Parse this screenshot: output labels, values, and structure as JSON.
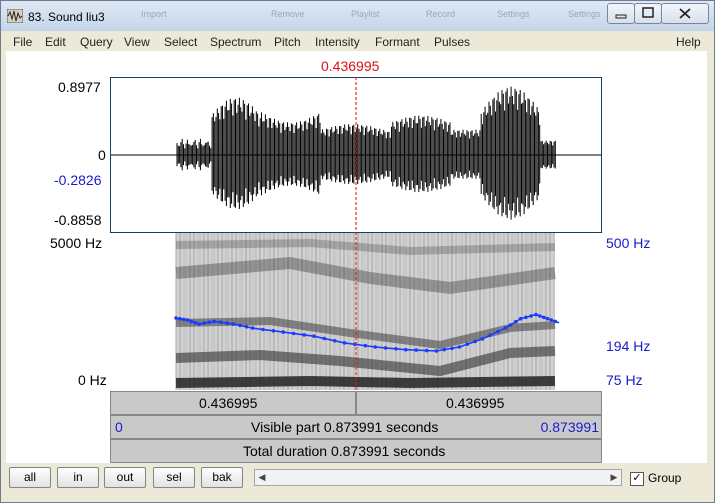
{
  "window": {
    "title": "83. Sound liu3",
    "ghost_titles": [
      "Import",
      "Remove",
      "Playlist",
      "Record",
      "Settings",
      "Settings"
    ]
  },
  "menu": {
    "items": [
      "File",
      "Edit",
      "Query",
      "View",
      "Select",
      "Spectrum",
      "Pitch",
      "Intensity",
      "Formant",
      "Pulses"
    ],
    "help": "Help"
  },
  "cursor": {
    "time": "0.436995"
  },
  "waveform": {
    "ymax": "0.8977",
    "zero": "0",
    "cursor_value": "-0.2826",
    "ymin": "-0.8858"
  },
  "spectrogram": {
    "freq_top": "5000 Hz",
    "freq_bottom": "0 Hz",
    "pitch_top": "500 Hz",
    "pitch_value": "194 Hz",
    "pitch_bottom": "75 Hz",
    "pitch_curve": [
      [
        0.0,
        0.755
      ],
      [
        0.03,
        0.77
      ],
      [
        0.06,
        0.8
      ],
      [
        0.1,
        0.78
      ],
      [
        0.15,
        0.8
      ],
      [
        0.2,
        0.83
      ],
      [
        0.28,
        0.86
      ],
      [
        0.36,
        0.89
      ],
      [
        0.44,
        0.94
      ],
      [
        0.52,
        0.97
      ],
      [
        0.6,
        0.99
      ],
      [
        0.68,
        1.0
      ],
      [
        0.74,
        0.97
      ],
      [
        0.8,
        0.91
      ],
      [
        0.86,
        0.83
      ],
      [
        0.9,
        0.76
      ],
      [
        0.94,
        0.73
      ],
      [
        0.97,
        0.76
      ],
      [
        1.0,
        0.79
      ]
    ]
  },
  "time_bar": {
    "left": "0.436995",
    "right": "0.436995"
  },
  "visible_bar": {
    "start": "0",
    "text": "Visible part 0.873991 seconds",
    "end": "0.873991"
  },
  "total_bar": {
    "text": "Total duration 0.873991 seconds"
  },
  "buttons": {
    "all": "all",
    "in": "in",
    "out": "out",
    "sel": "sel",
    "bak": "bak"
  },
  "group": {
    "label": "Group",
    "checked": true
  }
}
